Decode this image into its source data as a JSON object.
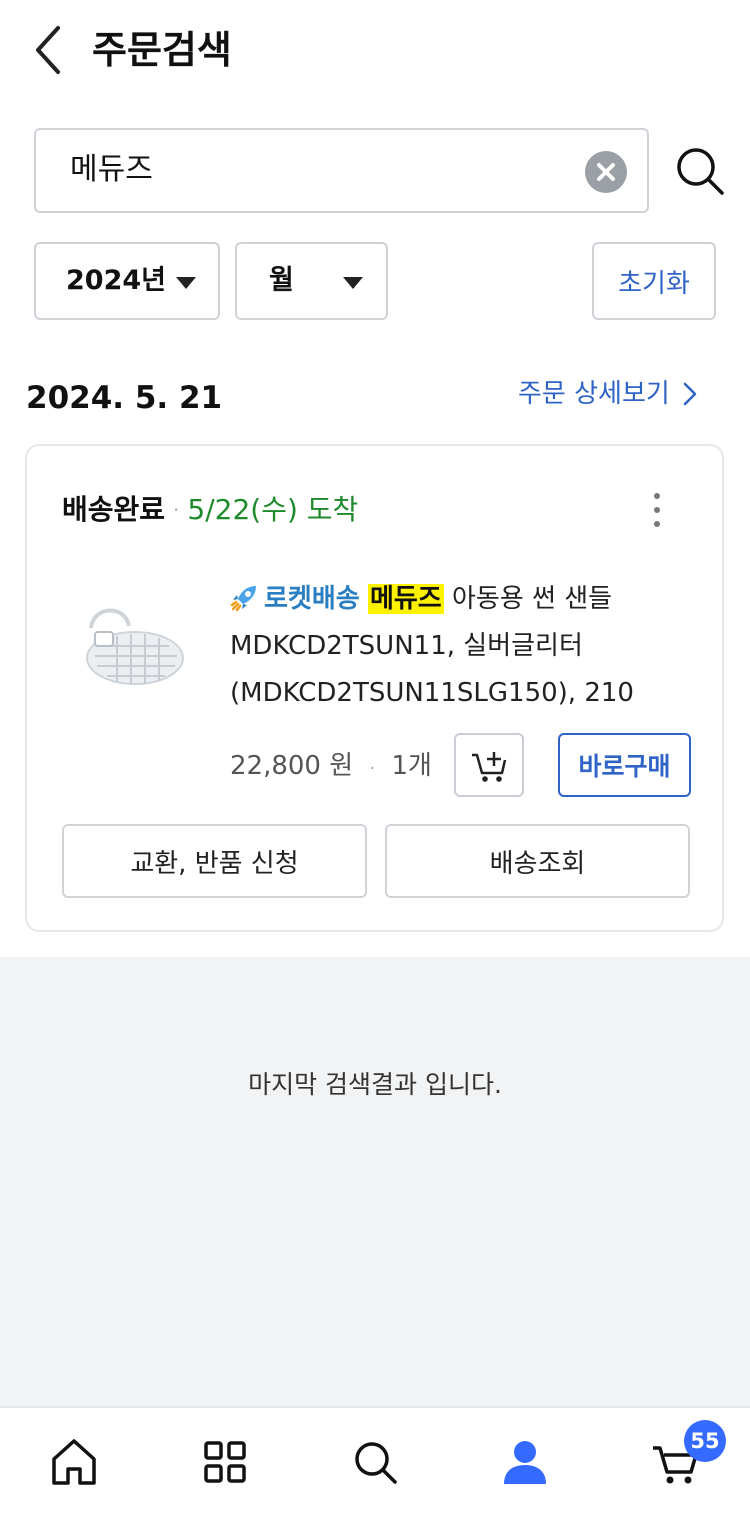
{
  "header": {
    "title": "주문검색"
  },
  "search": {
    "query": "메듀즈"
  },
  "filters": {
    "year": "2024년",
    "month": "월",
    "reset_label": "초기화"
  },
  "order": {
    "date": "2024. 5. 21",
    "detail_link": "주문 상세보기",
    "status": "배송완료",
    "arrival": "5/22(수) 도착",
    "product": {
      "delivery_label": "로켓배송",
      "brand": "메듀즈",
      "name": "아동용 썬 샌들 MDKCD2TSUN11, 실버글리터 (MDKCD2TSUN11SLG150), 210",
      "price": "22,800 원",
      "quantity": "1개"
    },
    "buy_now_label": "바로구매",
    "exchange_label": "교환, 반품 신청",
    "tracking_label": "배송조회"
  },
  "end_message": "마지막 검색결과 입니다.",
  "bottom_nav": {
    "cart_badge": "55"
  },
  "colors": {
    "accent": "#2f63c6",
    "arrival": "#1f8a2c",
    "highlight": "#fff200",
    "badge": "#346aff"
  }
}
